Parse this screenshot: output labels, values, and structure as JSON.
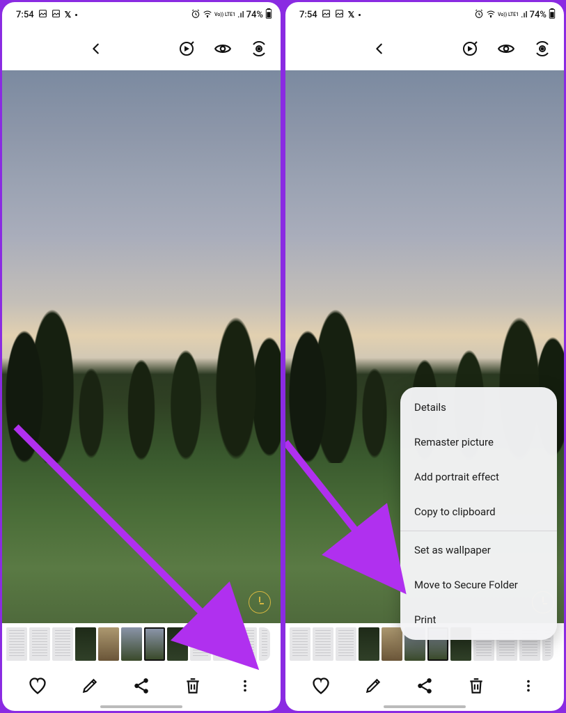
{
  "status": {
    "time": "7:54",
    "battery": "74%",
    "lte_label": "Vo)) LTE1",
    "signal_icon": ".ıl"
  },
  "menu": {
    "items": [
      "Details",
      "Remaster picture",
      "Add portrait effect",
      "Copy to clipboard",
      "Set as wallpaper",
      "Move to Secure Folder",
      "Print"
    ]
  }
}
